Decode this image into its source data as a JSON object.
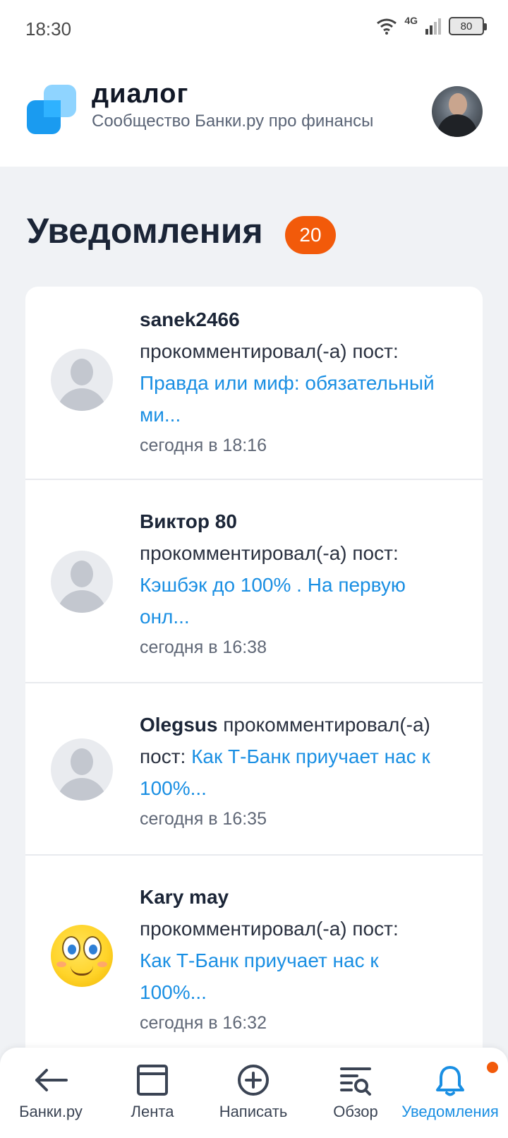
{
  "status_bar": {
    "time": "18:30",
    "network": "4G",
    "battery": "80"
  },
  "header": {
    "title": "диалог",
    "subtitle": "Сообщество Банки.ру про финансы"
  },
  "page": {
    "title": "Уведомления",
    "count": "20"
  },
  "notifications": [
    {
      "author": "sanek2466",
      "action": "прокомментировал(-а) пост:",
      "post": "Правда или миф: обязательный ми...",
      "time": "сегодня в 18:16"
    },
    {
      "author": "Виктор 80",
      "action": "прокомментировал(-а) пост:",
      "post": "Кэшбэк до 100% . На первую онл...",
      "time": "сегодня в 16:38"
    },
    {
      "author": "Olegsus",
      "action": "прокомментировал(-а) пост:",
      "post": "Как Т-Банк приучает нас к 100%...",
      "time": "сегодня в 16:35"
    },
    {
      "author": "Kary may",
      "action": "прокомментировал(-а) пост:",
      "post": "Как Т-Банк приучает нас к 100%...",
      "time": "сегодня в 16:32"
    }
  ],
  "nav": [
    {
      "label": "Банки.ру",
      "icon": "arrow-left-icon"
    },
    {
      "label": "Лента",
      "icon": "feed-icon"
    },
    {
      "label": "Написать",
      "icon": "plus-circle-icon"
    },
    {
      "label": "Обзор",
      "icon": "overview-search-icon"
    },
    {
      "label": "Уведомления",
      "icon": "bell-icon",
      "active": true
    }
  ],
  "colors": {
    "accent": "#1a8fe3",
    "badge": "#f25a0a",
    "background": "#f0f2f5"
  }
}
